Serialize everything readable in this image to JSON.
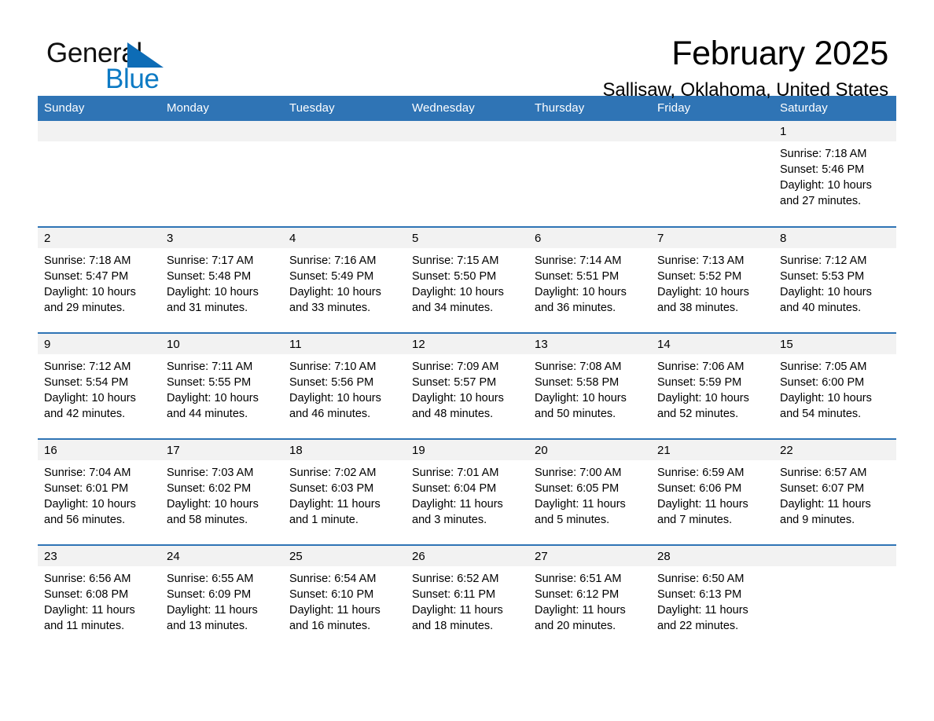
{
  "brand": {
    "name_part1": "General",
    "name_part2": "Blue",
    "triangle_icon": "triangle-icon",
    "accent_color": "#0d7ac4"
  },
  "header": {
    "title": "February 2025",
    "subtitle": "Sallisaw, Oklahoma, United States"
  },
  "theme": {
    "header_row_bg": "#2f74b5",
    "date_band_bg": "#f2f2f2",
    "row_divider": "#2f74b5",
    "text": "#000000"
  },
  "calendar": {
    "weekday_headers": [
      "Sunday",
      "Monday",
      "Tuesday",
      "Wednesday",
      "Thursday",
      "Friday",
      "Saturday"
    ],
    "weeks": [
      [
        {
          "date": "",
          "details": ""
        },
        {
          "date": "",
          "details": ""
        },
        {
          "date": "",
          "details": ""
        },
        {
          "date": "",
          "details": ""
        },
        {
          "date": "",
          "details": ""
        },
        {
          "date": "",
          "details": ""
        },
        {
          "date": "1",
          "details": "Sunrise: 7:18 AM\nSunset: 5:46 PM\nDaylight: 10 hours and 27 minutes."
        }
      ],
      [
        {
          "date": "2",
          "details": "Sunrise: 7:18 AM\nSunset: 5:47 PM\nDaylight: 10 hours and 29 minutes."
        },
        {
          "date": "3",
          "details": "Sunrise: 7:17 AM\nSunset: 5:48 PM\nDaylight: 10 hours and 31 minutes."
        },
        {
          "date": "4",
          "details": "Sunrise: 7:16 AM\nSunset: 5:49 PM\nDaylight: 10 hours and 33 minutes."
        },
        {
          "date": "5",
          "details": "Sunrise: 7:15 AM\nSunset: 5:50 PM\nDaylight: 10 hours and 34 minutes."
        },
        {
          "date": "6",
          "details": "Sunrise: 7:14 AM\nSunset: 5:51 PM\nDaylight: 10 hours and 36 minutes."
        },
        {
          "date": "7",
          "details": "Sunrise: 7:13 AM\nSunset: 5:52 PM\nDaylight: 10 hours and 38 minutes."
        },
        {
          "date": "8",
          "details": "Sunrise: 7:12 AM\nSunset: 5:53 PM\nDaylight: 10 hours and 40 minutes."
        }
      ],
      [
        {
          "date": "9",
          "details": "Sunrise: 7:12 AM\nSunset: 5:54 PM\nDaylight: 10 hours and 42 minutes."
        },
        {
          "date": "10",
          "details": "Sunrise: 7:11 AM\nSunset: 5:55 PM\nDaylight: 10 hours and 44 minutes."
        },
        {
          "date": "11",
          "details": "Sunrise: 7:10 AM\nSunset: 5:56 PM\nDaylight: 10 hours and 46 minutes."
        },
        {
          "date": "12",
          "details": "Sunrise: 7:09 AM\nSunset: 5:57 PM\nDaylight: 10 hours and 48 minutes."
        },
        {
          "date": "13",
          "details": "Sunrise: 7:08 AM\nSunset: 5:58 PM\nDaylight: 10 hours and 50 minutes."
        },
        {
          "date": "14",
          "details": "Sunrise: 7:06 AM\nSunset: 5:59 PM\nDaylight: 10 hours and 52 minutes."
        },
        {
          "date": "15",
          "details": "Sunrise: 7:05 AM\nSunset: 6:00 PM\nDaylight: 10 hours and 54 minutes."
        }
      ],
      [
        {
          "date": "16",
          "details": "Sunrise: 7:04 AM\nSunset: 6:01 PM\nDaylight: 10 hours and 56 minutes."
        },
        {
          "date": "17",
          "details": "Sunrise: 7:03 AM\nSunset: 6:02 PM\nDaylight: 10 hours and 58 minutes."
        },
        {
          "date": "18",
          "details": "Sunrise: 7:02 AM\nSunset: 6:03 PM\nDaylight: 11 hours and 1 minute."
        },
        {
          "date": "19",
          "details": "Sunrise: 7:01 AM\nSunset: 6:04 PM\nDaylight: 11 hours and 3 minutes."
        },
        {
          "date": "20",
          "details": "Sunrise: 7:00 AM\nSunset: 6:05 PM\nDaylight: 11 hours and 5 minutes."
        },
        {
          "date": "21",
          "details": "Sunrise: 6:59 AM\nSunset: 6:06 PM\nDaylight: 11 hours and 7 minutes."
        },
        {
          "date": "22",
          "details": "Sunrise: 6:57 AM\nSunset: 6:07 PM\nDaylight: 11 hours and 9 minutes."
        }
      ],
      [
        {
          "date": "23",
          "details": "Sunrise: 6:56 AM\nSunset: 6:08 PM\nDaylight: 11 hours and 11 minutes."
        },
        {
          "date": "24",
          "details": "Sunrise: 6:55 AM\nSunset: 6:09 PM\nDaylight: 11 hours and 13 minutes."
        },
        {
          "date": "25",
          "details": "Sunrise: 6:54 AM\nSunset: 6:10 PM\nDaylight: 11 hours and 16 minutes."
        },
        {
          "date": "26",
          "details": "Sunrise: 6:52 AM\nSunset: 6:11 PM\nDaylight: 11 hours and 18 minutes."
        },
        {
          "date": "27",
          "details": "Sunrise: 6:51 AM\nSunset: 6:12 PM\nDaylight: 11 hours and 20 minutes."
        },
        {
          "date": "28",
          "details": "Sunrise: 6:50 AM\nSunset: 6:13 PM\nDaylight: 11 hours and 22 minutes."
        },
        {
          "date": "",
          "details": ""
        }
      ]
    ]
  }
}
